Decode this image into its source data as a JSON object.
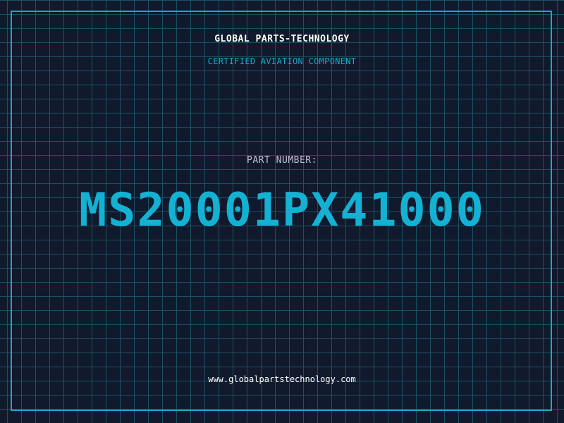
{
  "header": {
    "brand": "GLOBAL PARTS-TECHNOLOGY",
    "tagline": "CERTIFIED AVIATION COMPONENT"
  },
  "part": {
    "label": "PART NUMBER:",
    "number": "MS20001PX41000"
  },
  "footer": {
    "website": "www.globalpartstechnology.com"
  },
  "colors": {
    "background": "#111a2c",
    "grid": "#1f5a6e",
    "accent": "#1aa7c9",
    "text": "#ffffff",
    "muted": "#b9c2cf"
  }
}
